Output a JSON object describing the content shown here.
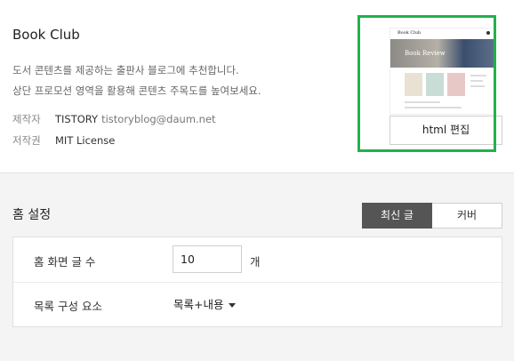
{
  "skin": {
    "title": "Book Club",
    "description_lines": [
      "도서 콘텐츠를 제공하는 출판사 블로그에 추천합니다.",
      "상단 프로모션 영역을 활용해 콘텐츠 주목도를 높여보세요."
    ],
    "author_label": "제작자",
    "author_name": "TISTORY",
    "author_email": "tistoryblog@daum.net",
    "license_label": "저작권",
    "license_value": "MIT License",
    "edit_button": "html 편집",
    "thumbnail": {
      "logo_text": "Book Club",
      "hero_text": "Book Review"
    }
  },
  "home_settings": {
    "title": "홈 설정",
    "tabs": [
      {
        "label": "최신 글",
        "active": true
      },
      {
        "label": "커버",
        "active": false
      }
    ],
    "post_count_label": "홈 화면 글 수",
    "post_count_value": "10",
    "post_count_unit": "개",
    "list_component_label": "목록 구성 요소",
    "list_component_value": "목록+내용"
  },
  "colors": {
    "highlight": "#22b14c",
    "active_tab": "#555555"
  }
}
